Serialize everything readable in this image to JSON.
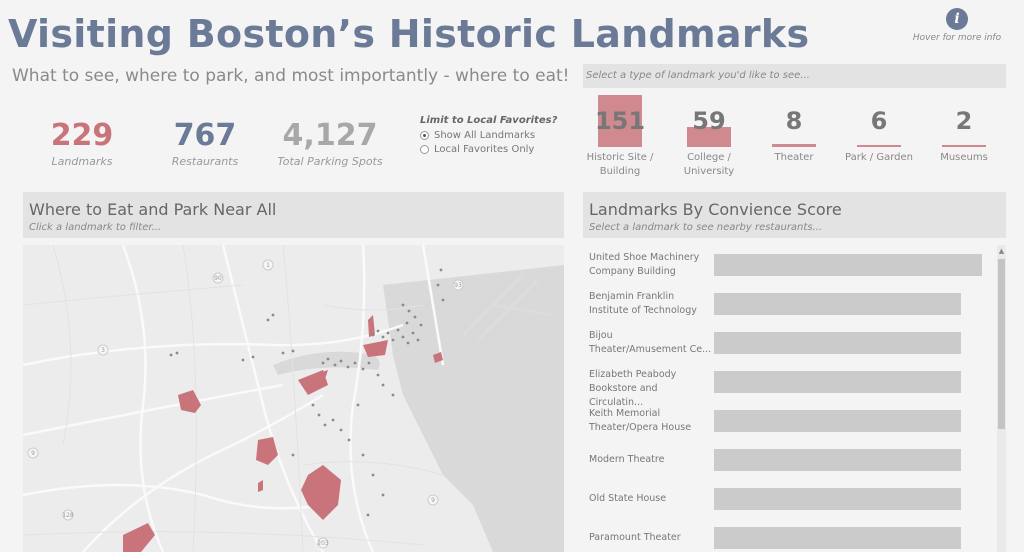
{
  "header": {
    "title": "Visiting Boston’s Historic Landmarks",
    "subtitle": "What to see, where to park, and most importantly - where to eat!",
    "info_label": "Hover for more info",
    "info_glyph": "i"
  },
  "kpis": [
    {
      "value": "229",
      "label": "Landmarks",
      "color": "#c9737a"
    },
    {
      "value": "767",
      "label": "Restaurants",
      "color": "#6b7a96"
    },
    {
      "value": "4,127",
      "label": "Total Parking Spots",
      "color": "#a8a8a8"
    }
  ],
  "filter": {
    "title": "Limit to Local Favorites?",
    "options": [
      {
        "label": "Show All Landmarks",
        "selected": true
      },
      {
        "label": "Local Favorites Only",
        "selected": false
      }
    ]
  },
  "landmark_type": {
    "placeholder": "Select a type of landmark you'd like to see...",
    "categories": [
      {
        "count": "151",
        "label_line1": "Historic Site /",
        "label_line2": "Building",
        "value": 151
      },
      {
        "count": "59",
        "label_line1": "College /",
        "label_line2": "University",
        "value": 59
      },
      {
        "count": "8",
        "label_line1": "Theater",
        "label_line2": "",
        "value": 8
      },
      {
        "count": "6",
        "label_line1": "Park / Garden",
        "label_line2": "",
        "value": 6
      },
      {
        "count": "2",
        "label_line1": "Museums",
        "label_line2": "",
        "value": 2
      }
    ]
  },
  "map_panel": {
    "title": "Where to Eat and Park Near All",
    "hint": "Click a landmark to filter...",
    "highway_labels": [
      "90",
      "93",
      "9",
      "128",
      "203",
      "3",
      "9",
      "1"
    ]
  },
  "convenience_panel": {
    "title": "Landmarks By Convience Score",
    "hint": "Select a landmark to see nearby restaurants...",
    "rows": [
      {
        "line1": "United Shoe Machinery",
        "line2": "Company Building",
        "score": 1.0
      },
      {
        "line1": "Benjamin Franklin",
        "line2": "Institute of Technology",
        "score": 0.92
      },
      {
        "line1": "Bijou",
        "line2": "Theater/Amusement Ce...",
        "score": 0.92
      },
      {
        "line1": "Elizabeth Peabody",
        "line2": "Bookstore and Circulatin...",
        "score": 0.92
      },
      {
        "line1": "Keith Memorial",
        "line2": "Theater/Opera House",
        "score": 0.92
      },
      {
        "line1": "Modern Theatre",
        "line2": "",
        "score": 0.92
      },
      {
        "line1": "Old State House",
        "line2": "",
        "score": 0.92
      },
      {
        "line1": "Paramount Theater",
        "line2": "",
        "score": 0.92
      }
    ]
  },
  "colors": {
    "accent": "#6b7a96",
    "landmark_red": "#c9737a",
    "bar_gray": "#cbcbcb"
  }
}
